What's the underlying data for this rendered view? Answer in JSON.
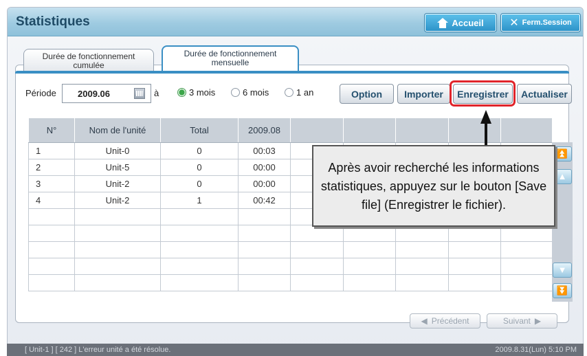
{
  "header": {
    "title": "Statistiques",
    "home_label": "Accueil",
    "logout_label": "Ferm.Session"
  },
  "tabs": [
    {
      "label_line1": "Durée de fonctionnement",
      "label_line2": "cumulée",
      "active": false
    },
    {
      "label_line1": "Durée de fonctionnement",
      "label_line2": "mensuelle",
      "active": true
    }
  ],
  "toolbar": {
    "period_label": "Période",
    "period_value": "2009.06",
    "to_label": "à",
    "radios": [
      {
        "label": "3 mois",
        "selected": true
      },
      {
        "label": "6 mois",
        "selected": false
      },
      {
        "label": "1 an",
        "selected": false
      }
    ],
    "option_label": "Option",
    "import_label": "Importer",
    "save_label": "Enregistrer",
    "refresh_label": "Actualiser"
  },
  "table": {
    "headers": [
      "N°",
      "Nom de l'unité",
      "Total",
      "2009.08",
      "",
      "",
      "",
      "",
      ""
    ],
    "rows": [
      [
        "1",
        "Unit-0",
        "0",
        "00:03",
        "",
        "",
        "",
        "",
        ""
      ],
      [
        "2",
        "Unit-5",
        "0",
        "00:00",
        "",
        "",
        "",
        "",
        ""
      ],
      [
        "3",
        "Unit-2",
        "0",
        "00:00",
        "",
        "",
        "",
        "",
        ""
      ],
      [
        "4",
        "Unit-2",
        "1",
        "00:42",
        "",
        "",
        "",
        "",
        ""
      ],
      [
        "",
        "",
        "",
        "",
        "",
        "",
        "",
        "",
        ""
      ],
      [
        "",
        "",
        "",
        "",
        "",
        "",
        "",
        "",
        ""
      ],
      [
        "",
        "",
        "",
        "",
        "",
        "",
        "",
        "",
        ""
      ],
      [
        "",
        "",
        "",
        "",
        "",
        "",
        "",
        "",
        ""
      ],
      [
        "",
        "",
        "",
        "",
        "",
        "",
        "",
        "",
        ""
      ]
    ]
  },
  "callout": {
    "text": "Après avoir recherché les informations statistiques, appuyez sur le bouton [Save file] (Enregistrer le fichier)."
  },
  "pager": {
    "prev_label": "Précédent",
    "next_label": "Suivant"
  },
  "status": {
    "message": "[ Unit-1 ] [ 242 ] L'erreur unité a été résolue.",
    "datetime": "2009.8.31(Lun) 5:10 PM"
  },
  "colors": {
    "accent": "#3a8fc4",
    "highlight": "#e0242a"
  }
}
